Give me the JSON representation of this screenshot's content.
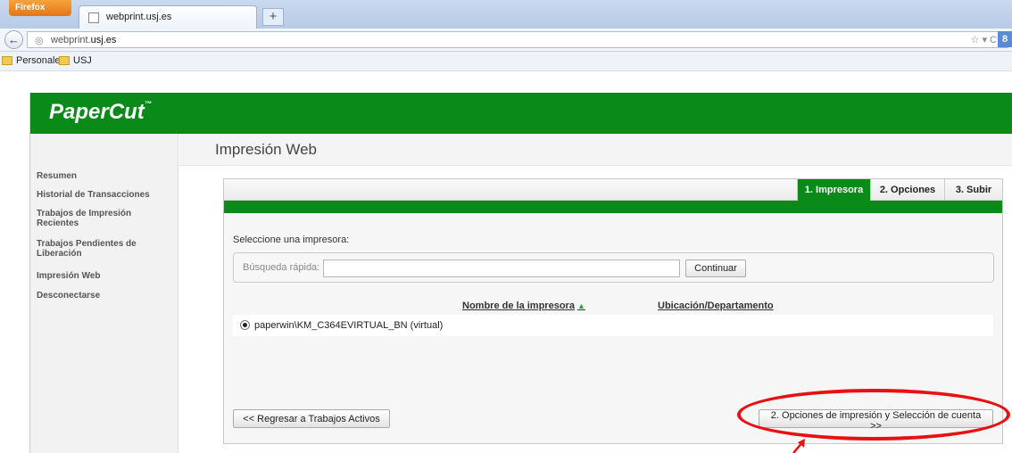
{
  "browser": {
    "firefox_label": "Firefox",
    "tab_title": "webprint.usj.es",
    "new_tab": "+",
    "back": "←",
    "url_prefix": "webprint.",
    "url_domain": "usj.es",
    "url_tools": "☆ ▾ C",
    "search_engine": "8",
    "bookmarks": [
      "Personales",
      "USJ"
    ]
  },
  "papercut": {
    "logo": "PaperCut",
    "logo_mark": "™",
    "page_title": "Impresión Web",
    "sidebar": [
      "Resumen",
      "Historial de Transacciones",
      "Trabajos de Impresión Recientes",
      "Trabajos Pendientes de Liberación",
      "Impresión Web",
      "Desconectarse"
    ],
    "steps": [
      "1. Impresora",
      "2. Opciones",
      "3. Subir"
    ],
    "select_label": "Seleccione una impresora:",
    "search_label": "Búsqueda rápida:",
    "search_value": "",
    "search_button": "Continuar",
    "col_printer": "Nombre de la impresora",
    "col_location": "Ubicación/Departamento",
    "sort_arrow": "▲",
    "printers": [
      "paperwin\\KM_C364EVIRTUAL_BN (virtual)"
    ],
    "back_button": "<< Regresar a Trabajos Activos",
    "next_button": "2. Opciones de impresión y Selección de cuenta >>"
  },
  "colors": {
    "papercut_green": "#0a8a19",
    "annotation_red": "#e81010"
  }
}
